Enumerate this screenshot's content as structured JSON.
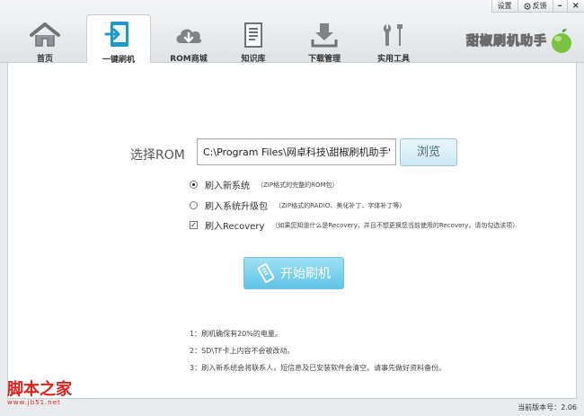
{
  "window": {
    "settings_label": "设置",
    "feedback_label": "反馈",
    "minimize_glyph": "–",
    "close_glyph": "×"
  },
  "tabs": [
    {
      "label": "首页",
      "icon": "home-icon"
    },
    {
      "label": "一键刷机",
      "icon": "flash-phone-icon",
      "active": true
    },
    {
      "label": "ROM商城",
      "icon": "cloud-download-icon"
    },
    {
      "label": "知识库",
      "icon": "document-icon"
    },
    {
      "label": "下载管理",
      "icon": "download-tray-icon"
    },
    {
      "label": "实用工具",
      "icon": "tools-icon"
    }
  ],
  "brand": {
    "text": "甜椒刷机助手",
    "icon": "apple-logo-icon"
  },
  "flash": {
    "rom_label": "选择ROM",
    "rom_path": "C:\\Program Files\\网卓科技\\甜椒刷机助手\\dov",
    "browse_label": "浏览",
    "options": [
      {
        "type": "radio",
        "checked": true,
        "label": "刷入新系统",
        "hint": "（ZIP格式的完整的ROM包）"
      },
      {
        "type": "radio",
        "checked": false,
        "label": "刷入系统升级包",
        "hint": "（ZIP格式的RADIO、美化补丁、字体补丁等）"
      },
      {
        "type": "checkbox",
        "checked": true,
        "label": "刷入Recovery",
        "hint": "（如果您知道什么是Recovery，并且不想更换您当前使用的Recovery，请勿勾选该项）"
      }
    ],
    "start_label": "开始刷机",
    "notes": [
      "1：刷机确保有20%的电量。",
      "2：SD\\TF卡上内容不会被改动。",
      "3：刷入新系统会将联系人，短信息及已安装软件会清空。请事先做好资料备份。"
    ]
  },
  "status": {
    "version_label": "当前版本号：",
    "version": "2.06"
  },
  "watermark": {
    "main": "脚本之家",
    "sub": "www.jb51.net"
  },
  "colors": {
    "accent": "#5fc4e6",
    "brand_green": "#7cc242",
    "watermark": "#e0201a"
  }
}
